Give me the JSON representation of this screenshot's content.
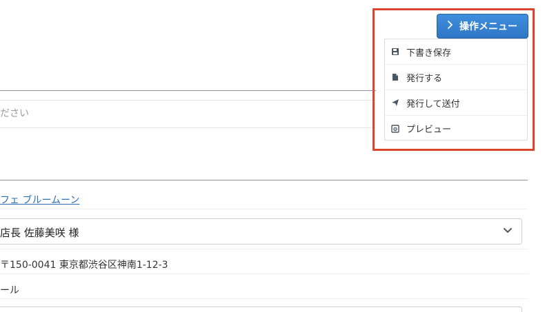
{
  "form": {
    "placeholder_partial": "ださい",
    "customer_link_partial": "フェ ブルームーン",
    "recipient_select": {
      "selected": "店長 佐藤美咲 様"
    },
    "address_partial": "〒150-0041 東京都渋谷区神南1-12-3",
    "contact_partial": "ール"
  },
  "operation_menu": {
    "button_label": "操作メニュー",
    "button_color": "#2f7fd0",
    "highlight_color": "#d9472b",
    "items": [
      {
        "label": "下書き保存",
        "icon": "save-icon"
      },
      {
        "label": "発行する",
        "icon": "document-icon"
      },
      {
        "label": "発行して送付",
        "icon": "send-icon"
      },
      {
        "label": "プレビュー",
        "icon": "preview-icon"
      }
    ]
  }
}
